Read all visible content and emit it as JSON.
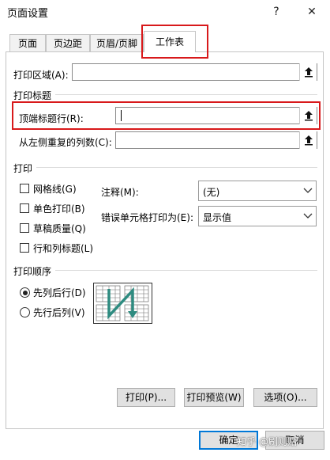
{
  "dialog": {
    "title": "页面设置",
    "help_glyph": "?",
    "close_glyph": "✕"
  },
  "tabs": [
    {
      "label": "页面"
    },
    {
      "label": "页边距"
    },
    {
      "label": "页眉/页脚"
    },
    {
      "label": "工作表",
      "active": true
    }
  ],
  "sheet": {
    "print_area_label": "打印区域(A):",
    "print_titles_group": "打印标题",
    "rows_to_repeat_label": "顶端标题行(R):",
    "cols_to_repeat_label": "从左侧重复的列数(C):",
    "print_group": "打印",
    "checkboxes": [
      {
        "label": "网格线(G)",
        "checked": false
      },
      {
        "label": "单色打印(B)",
        "checked": false
      },
      {
        "label": "草稿质量(Q)",
        "checked": false
      },
      {
        "label": "行和列标题(L)",
        "checked": false
      }
    ],
    "comments_label": "注释(M):",
    "comments_value": "(无)",
    "cell_errors_label": "错误单元格打印为(E):",
    "cell_errors_value": "显示值",
    "page_order_group": "打印顺序",
    "page_order_options": [
      {
        "label": "先列后行(D)",
        "selected": true
      },
      {
        "label": "先行后列(V)",
        "selected": false
      }
    ]
  },
  "panel_buttons": {
    "print": "打印(P)...",
    "preview": "打印预览(W)",
    "options": "选项(O)..."
  },
  "footer_buttons": {
    "ok": "确定",
    "cancel": "取消"
  },
  "watermark": "知乎 @刷则贴",
  "colors": {
    "highlight": "#d8191b",
    "primary_border": "#0078d7",
    "diagram_arrow": "#2e8b80"
  }
}
